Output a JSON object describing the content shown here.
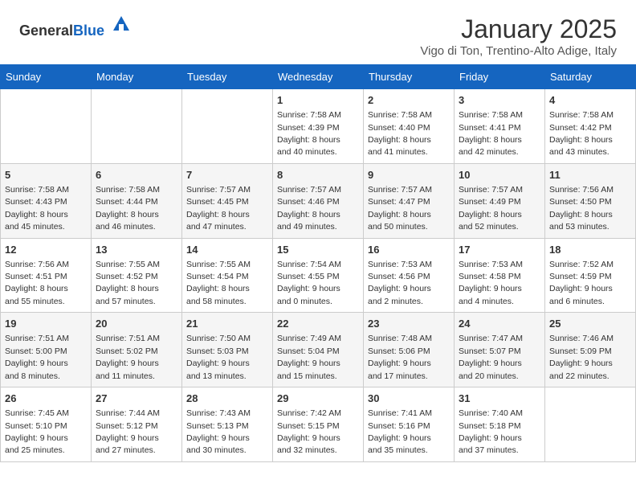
{
  "header": {
    "logo_general": "General",
    "logo_blue": "Blue",
    "title": "January 2025",
    "location": "Vigo di Ton, Trentino-Alto Adige, Italy"
  },
  "calendar": {
    "days_of_week": [
      "Sunday",
      "Monday",
      "Tuesday",
      "Wednesday",
      "Thursday",
      "Friday",
      "Saturday"
    ],
    "weeks": [
      [
        {
          "day": "",
          "info": ""
        },
        {
          "day": "",
          "info": ""
        },
        {
          "day": "",
          "info": ""
        },
        {
          "day": "1",
          "info": "Sunrise: 7:58 AM\nSunset: 4:39 PM\nDaylight: 8 hours\nand 40 minutes."
        },
        {
          "day": "2",
          "info": "Sunrise: 7:58 AM\nSunset: 4:40 PM\nDaylight: 8 hours\nand 41 minutes."
        },
        {
          "day": "3",
          "info": "Sunrise: 7:58 AM\nSunset: 4:41 PM\nDaylight: 8 hours\nand 42 minutes."
        },
        {
          "day": "4",
          "info": "Sunrise: 7:58 AM\nSunset: 4:42 PM\nDaylight: 8 hours\nand 43 minutes."
        }
      ],
      [
        {
          "day": "5",
          "info": "Sunrise: 7:58 AM\nSunset: 4:43 PM\nDaylight: 8 hours\nand 45 minutes."
        },
        {
          "day": "6",
          "info": "Sunrise: 7:58 AM\nSunset: 4:44 PM\nDaylight: 8 hours\nand 46 minutes."
        },
        {
          "day": "7",
          "info": "Sunrise: 7:57 AM\nSunset: 4:45 PM\nDaylight: 8 hours\nand 47 minutes."
        },
        {
          "day": "8",
          "info": "Sunrise: 7:57 AM\nSunset: 4:46 PM\nDaylight: 8 hours\nand 49 minutes."
        },
        {
          "day": "9",
          "info": "Sunrise: 7:57 AM\nSunset: 4:47 PM\nDaylight: 8 hours\nand 50 minutes."
        },
        {
          "day": "10",
          "info": "Sunrise: 7:57 AM\nSunset: 4:49 PM\nDaylight: 8 hours\nand 52 minutes."
        },
        {
          "day": "11",
          "info": "Sunrise: 7:56 AM\nSunset: 4:50 PM\nDaylight: 8 hours\nand 53 minutes."
        }
      ],
      [
        {
          "day": "12",
          "info": "Sunrise: 7:56 AM\nSunset: 4:51 PM\nDaylight: 8 hours\nand 55 minutes."
        },
        {
          "day": "13",
          "info": "Sunrise: 7:55 AM\nSunset: 4:52 PM\nDaylight: 8 hours\nand 57 minutes."
        },
        {
          "day": "14",
          "info": "Sunrise: 7:55 AM\nSunset: 4:54 PM\nDaylight: 8 hours\nand 58 minutes."
        },
        {
          "day": "15",
          "info": "Sunrise: 7:54 AM\nSunset: 4:55 PM\nDaylight: 9 hours\nand 0 minutes."
        },
        {
          "day": "16",
          "info": "Sunrise: 7:53 AM\nSunset: 4:56 PM\nDaylight: 9 hours\nand 2 minutes."
        },
        {
          "day": "17",
          "info": "Sunrise: 7:53 AM\nSunset: 4:58 PM\nDaylight: 9 hours\nand 4 minutes."
        },
        {
          "day": "18",
          "info": "Sunrise: 7:52 AM\nSunset: 4:59 PM\nDaylight: 9 hours\nand 6 minutes."
        }
      ],
      [
        {
          "day": "19",
          "info": "Sunrise: 7:51 AM\nSunset: 5:00 PM\nDaylight: 9 hours\nand 8 minutes."
        },
        {
          "day": "20",
          "info": "Sunrise: 7:51 AM\nSunset: 5:02 PM\nDaylight: 9 hours\nand 11 minutes."
        },
        {
          "day": "21",
          "info": "Sunrise: 7:50 AM\nSunset: 5:03 PM\nDaylight: 9 hours\nand 13 minutes."
        },
        {
          "day": "22",
          "info": "Sunrise: 7:49 AM\nSunset: 5:04 PM\nDaylight: 9 hours\nand 15 minutes."
        },
        {
          "day": "23",
          "info": "Sunrise: 7:48 AM\nSunset: 5:06 PM\nDaylight: 9 hours\nand 17 minutes."
        },
        {
          "day": "24",
          "info": "Sunrise: 7:47 AM\nSunset: 5:07 PM\nDaylight: 9 hours\nand 20 minutes."
        },
        {
          "day": "25",
          "info": "Sunrise: 7:46 AM\nSunset: 5:09 PM\nDaylight: 9 hours\nand 22 minutes."
        }
      ],
      [
        {
          "day": "26",
          "info": "Sunrise: 7:45 AM\nSunset: 5:10 PM\nDaylight: 9 hours\nand 25 minutes."
        },
        {
          "day": "27",
          "info": "Sunrise: 7:44 AM\nSunset: 5:12 PM\nDaylight: 9 hours\nand 27 minutes."
        },
        {
          "day": "28",
          "info": "Sunrise: 7:43 AM\nSunset: 5:13 PM\nDaylight: 9 hours\nand 30 minutes."
        },
        {
          "day": "29",
          "info": "Sunrise: 7:42 AM\nSunset: 5:15 PM\nDaylight: 9 hours\nand 32 minutes."
        },
        {
          "day": "30",
          "info": "Sunrise: 7:41 AM\nSunset: 5:16 PM\nDaylight: 9 hours\nand 35 minutes."
        },
        {
          "day": "31",
          "info": "Sunrise: 7:40 AM\nSunset: 5:18 PM\nDaylight: 9 hours\nand 37 minutes."
        },
        {
          "day": "",
          "info": ""
        }
      ]
    ]
  }
}
